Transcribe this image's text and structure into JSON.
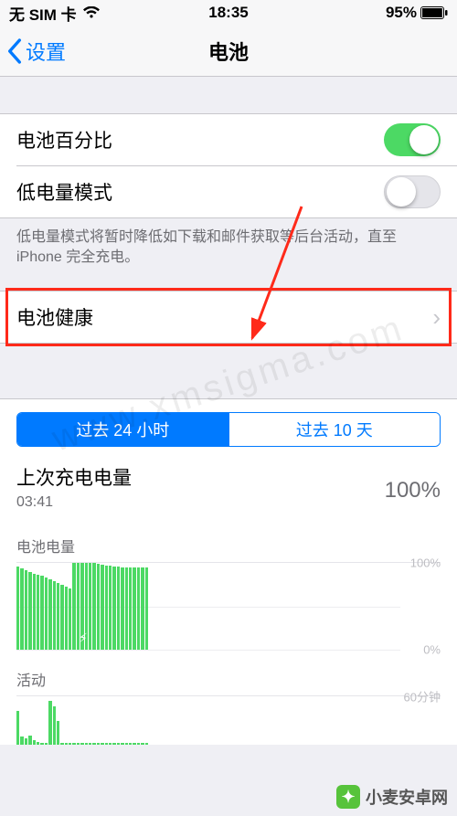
{
  "status": {
    "carrier": "无 SIM 卡",
    "time": "18:35",
    "battery_pct": "95%"
  },
  "nav": {
    "back": "设置",
    "title": "电池"
  },
  "rows": {
    "battery_percentage": {
      "label": "电池百分比",
      "on": true
    },
    "low_power": {
      "label": "低电量模式",
      "on": false
    },
    "footer": "低电量模式将暂时降低如下载和邮件获取等后台活动，直至 iPhone 完全充电。",
    "battery_health": {
      "label": "电池健康"
    }
  },
  "seg": {
    "a": "过去 24 小时",
    "b": "过去 10 天",
    "active": 0
  },
  "last_charge": {
    "title": "上次充电电量",
    "time": "03:41",
    "pct": "100%"
  },
  "chart_data": [
    {
      "type": "bar",
      "title": "电池电量",
      "ylabel": "%",
      "ylim": [
        0,
        100
      ],
      "axis_top": "100%",
      "axis_bottom": "0%",
      "values": [
        96,
        94,
        92,
        90,
        88,
        87,
        85,
        83,
        81,
        79,
        77,
        75,
        73,
        71,
        100,
        100,
        100,
        100,
        100,
        100,
        99,
        98,
        97,
        97,
        96,
        96,
        95,
        95,
        95,
        95,
        95,
        95,
        95,
        0,
        0,
        0,
        0,
        0,
        0,
        0,
        0,
        0,
        0,
        0,
        0,
        0,
        0,
        0,
        0,
        0,
        0,
        0,
        0,
        0,
        0,
        0,
        0,
        0,
        0,
        0,
        0,
        0,
        0,
        0,
        0,
        0,
        0,
        0,
        0,
        0,
        0,
        0,
        0,
        0,
        0,
        0,
        0,
        0,
        0,
        0,
        0,
        0,
        0,
        0,
        0,
        0,
        0,
        0,
        0,
        0,
        0,
        0,
        0,
        0,
        0,
        0
      ]
    },
    {
      "type": "bar",
      "title": "活动",
      "ylabel": "分钟",
      "ylim": [
        0,
        60
      ],
      "axis_top": "60分钟",
      "values": [
        42,
        10,
        8,
        12,
        6,
        4,
        3,
        2,
        55,
        48,
        30,
        2,
        2,
        2,
        2,
        2,
        2,
        2,
        2,
        2,
        2,
        2,
        2,
        2,
        2,
        2,
        2,
        2,
        2,
        2,
        2,
        2,
        2,
        0,
        0,
        0,
        0,
        0,
        0,
        0,
        0,
        0,
        0,
        0,
        0,
        0,
        0,
        0,
        0,
        0,
        0,
        0,
        0,
        0,
        0,
        0,
        0,
        0,
        0,
        0,
        0,
        0,
        0,
        0,
        0,
        0,
        0,
        0,
        0,
        0,
        0,
        0,
        0,
        0,
        0,
        0,
        0,
        0,
        0,
        0,
        0,
        0,
        0,
        0,
        0,
        0,
        0,
        0,
        0,
        0,
        0,
        0,
        0,
        0,
        0,
        0
      ]
    }
  ],
  "watermark": {
    "diag": "www.xmsigma.com",
    "corner": "小麦安卓网"
  }
}
